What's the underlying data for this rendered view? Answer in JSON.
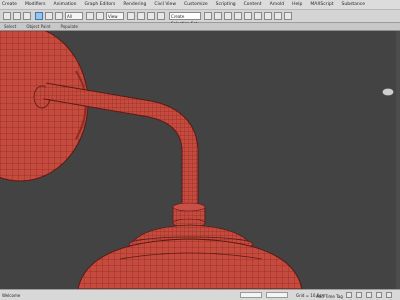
{
  "menubar": {
    "items": [
      "Create",
      "Modifiers",
      "Animation",
      "Graph Editors",
      "Rendering",
      "Civil View",
      "Customize",
      "Scripting",
      "Content",
      "Arnold",
      "Help",
      "MAXScript",
      "Substance"
    ]
  },
  "toolbar": {
    "dropdown_label": "All",
    "view_dropdown": "View",
    "selection_set": "Create Selection Set"
  },
  "ribbon": {
    "tabs": [
      "Select",
      "Object Paint",
      "Populate"
    ]
  },
  "status": {
    "left_label": "Welcome",
    "grid_label": "Grid = 10.0cm",
    "add_time_tag": "Add Time Tag"
  },
  "colors": {
    "mesh": "#c64a3d",
    "wire": "#6b201a",
    "background": "#434343"
  }
}
